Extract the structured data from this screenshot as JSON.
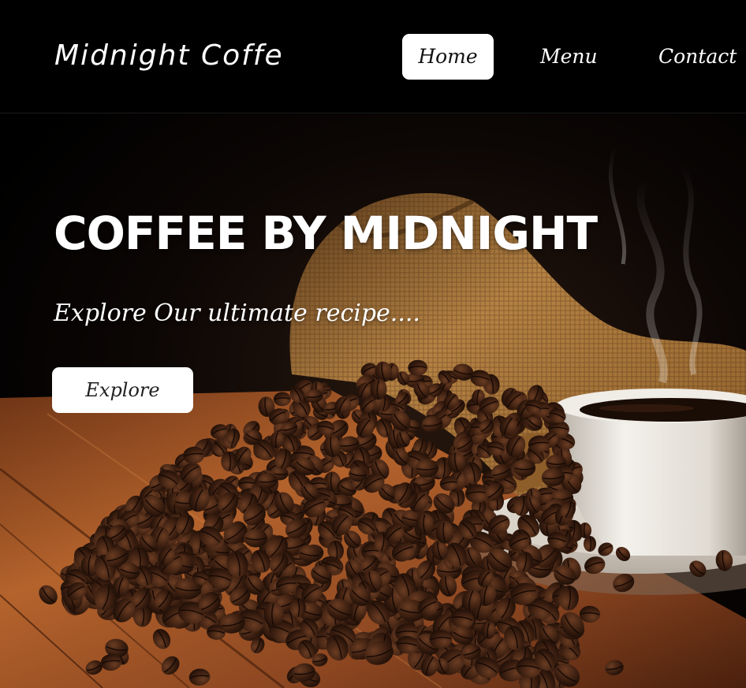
{
  "header": {
    "logo": "Midnight Coffe",
    "nav": {
      "home": "Home",
      "menu": "Menu",
      "contact": "Contact"
    }
  },
  "hero": {
    "title": "COFFEE BY MIDNIGHT",
    "subtitle": "Explore Our ultimate recipe....",
    "button_label": "Explore"
  },
  "colors": {
    "background": "#000000",
    "text": "#ffffff",
    "button_bg": "#ffffff",
    "button_text": "#222222",
    "wood": "#8a4a22",
    "burlap": "#a8773c",
    "bean": "#3a2014",
    "cup": "#ece8e2"
  }
}
